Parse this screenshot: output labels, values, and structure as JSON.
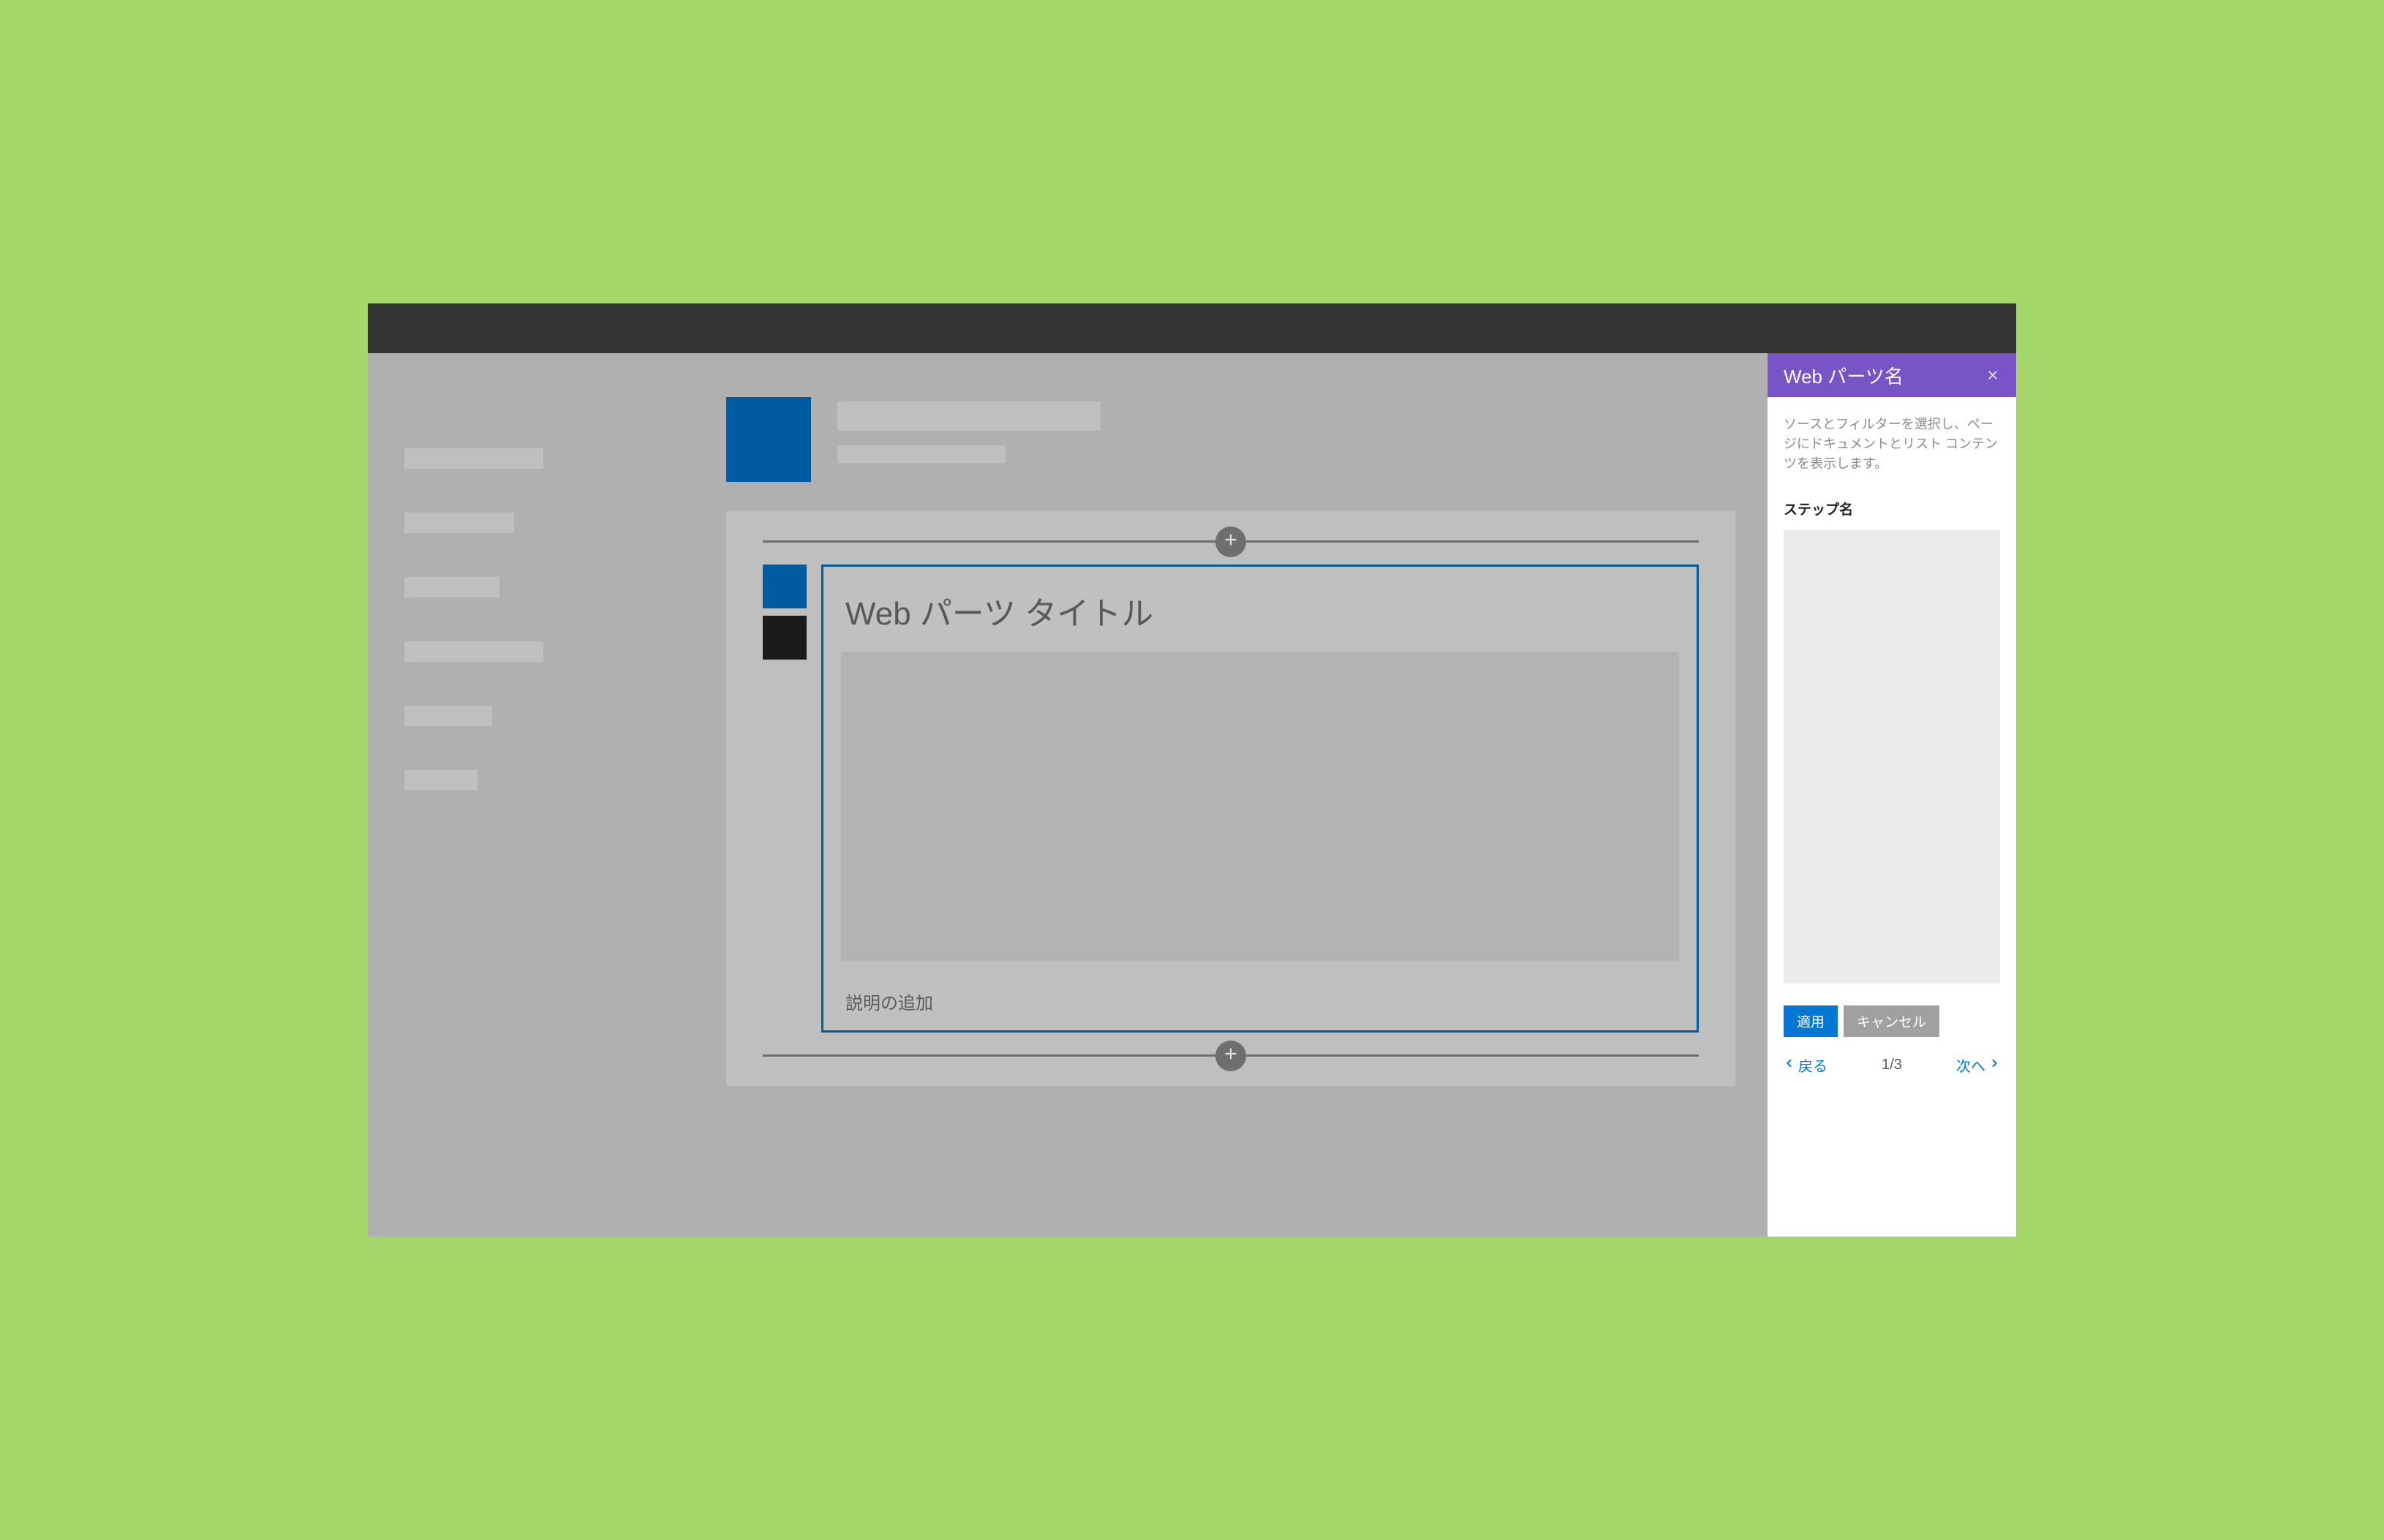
{
  "colors": {
    "background": "#a4d669",
    "accent_purple": "#7954c7",
    "accent_blue": "#005ba1",
    "link_blue": "#0078d4"
  },
  "webpart": {
    "title": "Web パーツ タイトル",
    "caption": "説明の追加"
  },
  "panel": {
    "title": "Web パーツ名",
    "description": "ソースとフィルターを選択し、ページにドキュメントとリスト コンテンツを表示します。",
    "step_label": "ステップ名",
    "apply_label": "適用",
    "cancel_label": "キャンセル",
    "back_label": "戻る",
    "next_label": "次へ",
    "page_indicator": "1/3"
  },
  "icons": {
    "close": "close-icon",
    "plus": "plus-icon",
    "chevron_left": "chevron-left-icon",
    "chevron_right": "chevron-right-icon"
  }
}
